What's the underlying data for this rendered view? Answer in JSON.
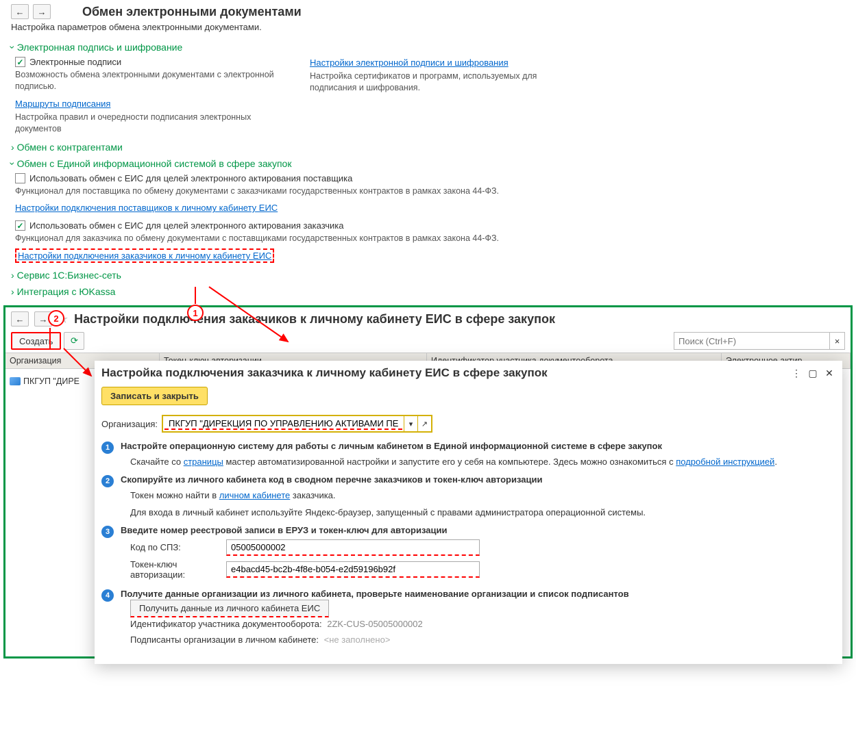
{
  "nav": {
    "back": "←",
    "forward": "→"
  },
  "page": {
    "title": "Обмен электронными документами",
    "subtitle": "Настройка параметров обмена электронными документами."
  },
  "sections": {
    "sig": {
      "title": "Электронная подпись и шифрование",
      "chk_label": "Электронные подписи",
      "chk_desc": "Возможность обмена электронными документами с электронной подписью.",
      "routes_link": "Маршруты подписания",
      "routes_desc": "Настройка правил и очередности подписания электронных документов",
      "cfg_link": "Настройки электронной подписи и шифрования",
      "cfg_desc": "Настройка сертификатов и программ, используемых для подписания и шифрования."
    },
    "contr": {
      "title": "Обмен с контрагентами"
    },
    "eis": {
      "title": "Обмен с Единой информационной системой в сфере закупок",
      "chk1_label": "Использовать обмен с ЕИС для целей электронного актирования поставщика",
      "chk1_desc": "Функционал для поставщика по обмену документами с заказчиками государственных контрактов в рамках закона 44-ФЗ.",
      "link1": "Настройки подключения поставщиков к личному кабинету ЕИС",
      "chk2_label": "Использовать обмен с ЕИС для целей электронного актирования заказчика",
      "chk2_desc": "Функционал для заказчика по обмену документами с поставщиками государственных контрактов в рамках закона 44-ФЗ.",
      "link2": "Настройки подключения заказчиков к личному кабинету ЕИС"
    },
    "biznet": {
      "title": "Сервис 1С:Бизнес-сеть"
    },
    "yookassa": {
      "title": "Интеграция с ЮKassa"
    }
  },
  "callouts": {
    "one": "1",
    "two": "2"
  },
  "window2": {
    "title": "Настройки подключения заказчиков к личному кабинету ЕИС в сфере закупок",
    "create": "Создать",
    "search_placeholder": "Поиск (Ctrl+F)",
    "cols": {
      "org": "Организация",
      "token": "Токен-ключ авторизации",
      "ident": "Идентификатор участника документооборота",
      "eact": "Электронное актир"
    },
    "row": {
      "org": "ПКГУП \"ДИРЕ"
    }
  },
  "dialog": {
    "title": "Настройка подключения заказчика к личному кабинету ЕИС в сфере закупок",
    "save_close": "Записать и закрыть",
    "org_label": "Организация:",
    "org_value": "ПКГУП \"ДИРЕКЦИЯ ПО УПРАВЛЕНИЮ АКТИВАМИ ПЕРМС",
    "steps": {
      "s1": {
        "title": "Настройте операционную систему для работы с личным кабинетом в Единой информационной системе в сфере закупок",
        "t1": "Скачайте со ",
        "link1": "страницы",
        "t2": " мастер автоматизированной настройки и запустите его у себя на компьютере. Здесь можно ознакомиться с ",
        "link2": "подробной инструкцией",
        "t3": "."
      },
      "s2": {
        "title": "Скопируйте из личного кабинета код в сводном перечне заказчиков и токен-ключ авторизации",
        "t1": "Токен можно найти в ",
        "link1": "личном кабинете",
        "t2": " заказчика.",
        "t3": "Для входа в личный кабинет используйте Яндекс-браузер, запущенный с правами администратора операционной системы."
      },
      "s3": {
        "title": "Введите номер реестровой записи в ЕРУЗ и токен-ключ для авторизации",
        "code_label": "Код по СПЗ:",
        "code_value": "05005000002",
        "token_label": "Токен-ключ авторизации:",
        "token_value": "e4bacd45-bc2b-4f8e-b054-e2d59196b92f"
      },
      "s4": {
        "title": "Получите данные организации из личного кабинета, проверьте наименование организации и список подписантов",
        "btn": "Получить данные из личного кабинета ЕИС",
        "id_label": "Идентификатор участника документооборота:",
        "id_value": "2ZK-CUS-05005000002",
        "signers_label": "Подписанты организации в личном кабинете:",
        "signers_value": "<не заполнено>"
      }
    }
  }
}
